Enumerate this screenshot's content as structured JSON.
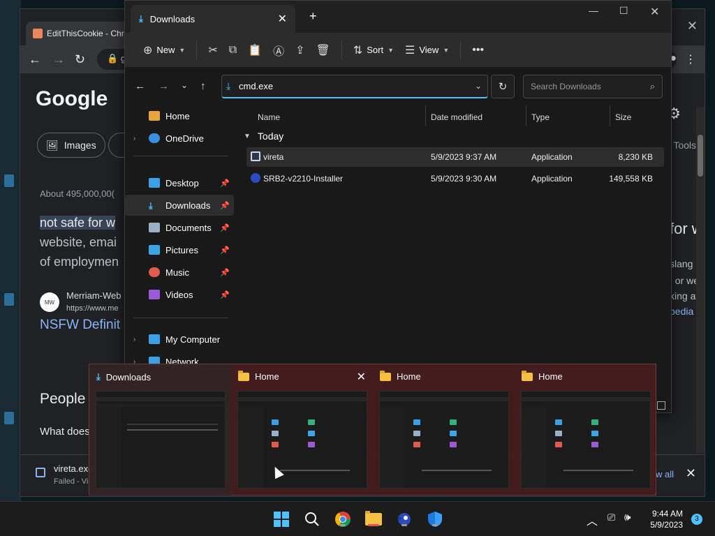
{
  "chrome": {
    "tab_title": "EditThisCookie - Chr",
    "address_partial": "g",
    "google_logo": "Google",
    "chip_images": "Images",
    "tools": "Tools",
    "about": "About 495,000,00(",
    "snippet_highlight": "not safe for w",
    "snippet_line2": "website, emai",
    "snippet_line3": "of employmen",
    "source_name": "Merriam-Web",
    "source_url": "https://www.me",
    "result_link": "NSFW Definit",
    "people_heading": "People",
    "what_does": "What does",
    "right_big": "for w",
    "right_line1": "slang c",
    "right_line2": ", or we",
    "right_line3": "king at",
    "right_link": "pedia",
    "download_name": "vireta.exe",
    "download_status": "Failed - Vir",
    "show_all": "w all"
  },
  "explorer": {
    "tab_title": "Downloads",
    "commands": {
      "new": "New",
      "sort": "Sort",
      "view": "View"
    },
    "address": "cmd.exe",
    "search_placeholder": "Search Downloads",
    "nav": [
      {
        "label": "Home",
        "pinned": false
      },
      {
        "label": "OneDrive",
        "pinned": false
      },
      {
        "label": "Desktop",
        "pinned": true
      },
      {
        "label": "Downloads",
        "pinned": true
      },
      {
        "label": "Documents",
        "pinned": true
      },
      {
        "label": "Pictures",
        "pinned": true
      },
      {
        "label": "Music",
        "pinned": true
      },
      {
        "label": "Videos",
        "pinned": true
      },
      {
        "label": "My Computer",
        "pinned": false
      },
      {
        "label": "Network",
        "pinned": false
      }
    ],
    "columns": {
      "name": "Name",
      "date": "Date modified",
      "type": "Type",
      "size": "Size"
    },
    "group": "Today",
    "files": [
      {
        "name": "vireta",
        "date": "5/9/2023 9:37 AM",
        "type": "Application",
        "size": "8,230 KB"
      },
      {
        "name": "SRB2-v2210-Installer",
        "date": "5/9/2023 9:30 AM",
        "type": "Application",
        "size": "149,558 KB"
      }
    ]
  },
  "switcher": [
    {
      "title": "Downloads",
      "icon": "download-icon"
    },
    {
      "title": "Home",
      "icon": "folder-icon"
    },
    {
      "title": "Home",
      "icon": "folder-icon"
    },
    {
      "title": "Home",
      "icon": "folder-icon"
    }
  ],
  "taskbar": {
    "time": "9:44 AM",
    "date": "5/9/2023",
    "notification_count": "3"
  }
}
